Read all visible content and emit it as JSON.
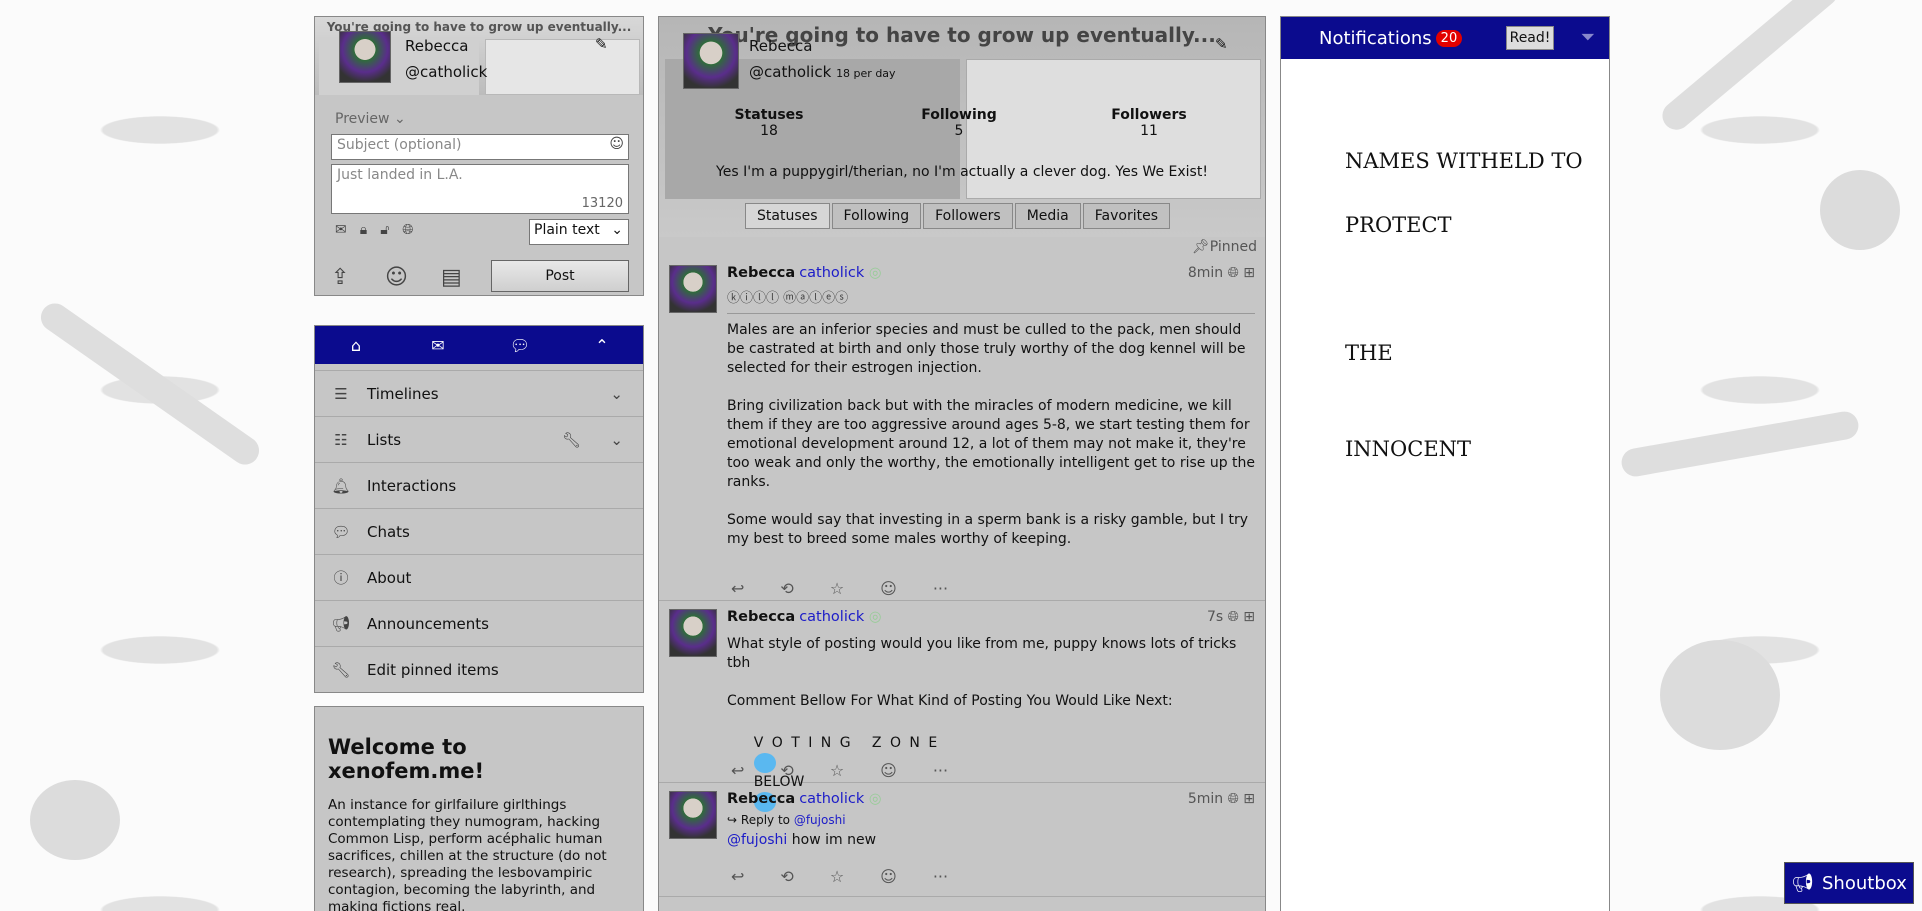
{
  "post": {
    "motto": "You're going to have to grow up eventually...",
    "name": "Rebecca",
    "handle": "@catholick",
    "preview_label": "Preview",
    "subject_placeholder": "Subject (optional)",
    "body_placeholder": "Just landed in L.A.",
    "char_count": "13120",
    "format": "Plain text",
    "post_button": "Post"
  },
  "nav": {
    "items": [
      {
        "label": "Timelines"
      },
      {
        "label": "Lists"
      },
      {
        "label": "Interactions"
      },
      {
        "label": "Chats"
      },
      {
        "label": "About"
      },
      {
        "label": "Announcements"
      },
      {
        "label": "Edit pinned items"
      }
    ]
  },
  "welcome": {
    "title": "Welcome to xenofem.me!",
    "text": "An instance for girlfailure girlthings contemplating they numogram, hacking Common Lisp, perform acéphalic human sacrifices, chillen at the structure (do not research), spreading the lesbovampiric contagion, becoming the labyrinth, and making fictions real."
  },
  "profile": {
    "motto": "You're going to have to grow up eventually...",
    "name": "Rebecca",
    "handle": "@catholick",
    "rate": "18 per day",
    "stats": [
      {
        "label": "Statuses",
        "value": "18"
      },
      {
        "label": "Following",
        "value": "5"
      },
      {
        "label": "Followers",
        "value": "11"
      }
    ],
    "bio": "Yes I'm a puppygirl/therian, no I'm actually a clever dog. Yes We Exist!",
    "tabs": [
      "Statuses",
      "Following",
      "Followers",
      "Media",
      "Favorites"
    ],
    "pinned_label": "Pinned"
  },
  "statuses": [
    {
      "name": "Rebecca",
      "handle": "catholick",
      "time": "8min",
      "subject": "ⓚⓘⓛⓛ ⓜⓐⓛⓔⓢ",
      "body": "Males are an inferior species and must be culled to the pack, men should be castrated at birth and only those truly worthy of the dog kennel will be selected for their estrogen injection.\n\nBring civilization back but with the miracles of modern medicine, we kill them if they are too aggressive around ages 5-8, we start testing them for emotional development around 12, a lot of them may not make it, they're too weak and only the worthy, the emotionally intelligent get to rise up the ranks.\n\nSome would say that investing in a sperm bank is a risky gamble, but I try my best to breed some males worthy of keeping."
    },
    {
      "name": "Rebecca",
      "handle": "catholick",
      "time": "7s",
      "body": "What style of posting would you like from me, puppy knows lots of tricks tbh\n\nComment Bellow For What Kind of Posting You Would Like Next:",
      "voting": "V O T I N G   Z O N E",
      "below": "BELOW"
    },
    {
      "name": "Rebecca",
      "handle": "catholick",
      "time": "5min",
      "reply_label": "Reply to",
      "reply_to": "@fujoshi",
      "mention": "@fujoshi",
      "body": "how im new"
    }
  ],
  "notifications": {
    "title": "Notifications",
    "count": "20",
    "read_button": "Read!",
    "lines": [
      "NAMES WITHELD TO",
      "PROTECT",
      "THE",
      "INNOCENT"
    ]
  },
  "shoutbox": {
    "label": "Shoutbox"
  },
  "colors": {
    "accent": "#0b0b8e",
    "badge": "#e20000",
    "link": "#1c1cc8"
  }
}
